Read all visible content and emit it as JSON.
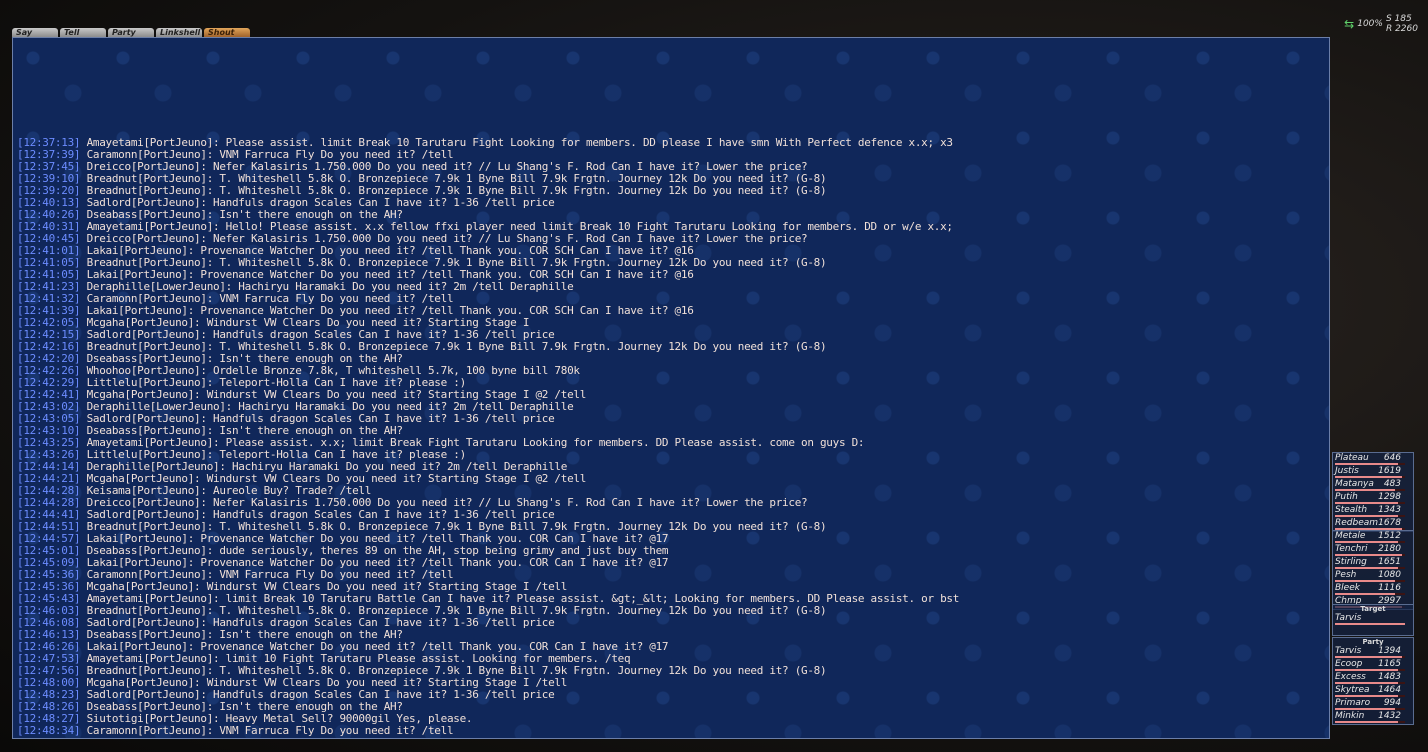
{
  "tabs": [
    {
      "label": "Say"
    },
    {
      "label": "Tell"
    },
    {
      "label": "Party"
    },
    {
      "label": "Linkshell"
    },
    {
      "label": "Shout"
    }
  ],
  "status": {
    "pct": "100%",
    "s": "S 185",
    "r": "R 2260"
  },
  "chat": {
    "lines": [
      {
        "ts": "[12:37:13]",
        "text": "Amayetami[PortJeuno]: Please assist. limit Break 10 Tarutaru Fight Looking for members. DD please I have smn With Perfect defence x.x; x3"
      },
      {
        "ts": "[12:37:39]",
        "text": "Caramonn[PortJeuno]: VNM Farruca Fly Do you need it? /tell"
      },
      {
        "ts": "[12:37:45]",
        "text": "Dreicco[PortJeuno]: Nefer Kalasiris 1.750.000 Do you need it? // Lu Shang's F. Rod Can I have it? Lower the price?"
      },
      {
        "ts": "[12:39:10]",
        "text": "Breadnut[PortJeuno]: T. Whiteshell 5.8k O. Bronzepiece 7.9k 1 Byne Bill 7.9k Frgtn. Journey 12k Do you need it? (G-8)"
      },
      {
        "ts": "[12:39:20]",
        "text": "Breadnut[PortJeuno]: T. Whiteshell 5.8k O. Bronzepiece 7.9k 1 Byne Bill 7.9k Frgtn. Journey 12k Do you need it? (G-8)"
      },
      {
        "ts": "[12:40:13]",
        "text": "Sadlord[PortJeuno]: Handfuls dragon Scales Can I have it? 1-36 /tell price"
      },
      {
        "ts": "[12:40:26]",
        "text": "Dseabass[PortJeuno]: Isn't there enough on the AH?"
      },
      {
        "ts": "[12:40:31]",
        "text": "Amayetami[PortJeuno]: Hello! Please assist. x.x fellow ffxi player need limit Break 10 Fight Tarutaru Looking for members. DD or w/e x.x;"
      },
      {
        "ts": "[12:40:45]",
        "text": "Dreicco[PortJeuno]: Nefer Kalasiris 1.750.000 Do you need it? // Lu Shang's F. Rod Can I have it? Lower the price?"
      },
      {
        "ts": "[12:41:01]",
        "text": "Lakai[PortJeuno]: Provenance Watcher Do you need it? /tell Thank you. COR SCH Can I have it? @16"
      },
      {
        "ts": "[12:41:05]",
        "text": "Breadnut[PortJeuno]: T. Whiteshell 5.8k O. Bronzepiece 7.9k 1 Byne Bill 7.9k Frgtn. Journey 12k Do you need it? (G-8)"
      },
      {
        "ts": "[12:41:05]",
        "text": "Lakai[PortJeuno]: Provenance Watcher Do you need it? /tell Thank you. COR SCH Can I have it? @16"
      },
      {
        "ts": "[12:41:23]",
        "text": "Deraphille[LowerJeuno]: Hachiryu Haramaki Do you need it? 2m /tell Deraphille"
      },
      {
        "ts": "[12:41:32]",
        "text": "Caramonn[PortJeuno]: VNM Farruca Fly Do you need it? /tell"
      },
      {
        "ts": "[12:41:39]",
        "text": "Lakai[PortJeuno]: Provenance Watcher Do you need it? /tell Thank you. COR SCH Can I have it? @16"
      },
      {
        "ts": "[12:42:05]",
        "text": "Mcgaha[PortJeuno]: Windurst VW Clears Do you need it? Starting Stage I"
      },
      {
        "ts": "[12:42:15]",
        "text": "Sadlord[PortJeuno]: Handfuls dragon Scales Can I have it? 1-36 /tell price"
      },
      {
        "ts": "[12:42:16]",
        "text": "Breadnut[PortJeuno]: T. Whiteshell 5.8k O. Bronzepiece 7.9k 1 Byne Bill 7.9k Frgtn. Journey 12k Do you need it? (G-8)"
      },
      {
        "ts": "[12:42:20]",
        "text": "Dseabass[PortJeuno]: Isn't there enough on the AH?"
      },
      {
        "ts": "[12:42:26]",
        "text": "Whoohoo[PortJeuno]: Ordelle Bronze 7.8k, T whiteshell 5.7k, 100 byne bill 780k"
      },
      {
        "ts": "[12:42:29]",
        "text": "Littlelu[PortJeuno]: Teleport-Holla Can I have it? please :)"
      },
      {
        "ts": "[12:42:41]",
        "text": "Mcgaha[PortJeuno]: Windurst VW Clears Do you need it? Starting Stage I @2 /tell"
      },
      {
        "ts": "[12:43:02]",
        "text": "Deraphille[LowerJeuno]: Hachiryu Haramaki Do you need it? 2m /tell Deraphille"
      },
      {
        "ts": "[12:43:05]",
        "text": "Sadlord[PortJeuno]: Handfuls dragon Scales Can I have it? 1-36 /tell price"
      },
      {
        "ts": "[12:43:10]",
        "text": "Dseabass[PortJeuno]: Isn't there enough on the AH?"
      },
      {
        "ts": "[12:43:25]",
        "text": "Amayetami[PortJeuno]: Please assist. x.x; limit Break Fight Tarutaru Looking for members. DD Please assist. come on guys D:"
      },
      {
        "ts": "[12:43:26]",
        "text": "Littlelu[PortJeuno]: Teleport-Holla Can I have it? please :)"
      },
      {
        "ts": "[12:44:14]",
        "text": "Deraphille[PortJeuno]: Hachiryu Haramaki Do you need it? 2m /tell Deraphille"
      },
      {
        "ts": "[12:44:21]",
        "text": "Mcgaha[PortJeuno]: Windurst VW Clears Do you need it? Starting Stage I @2 /tell"
      },
      {
        "ts": "[12:44:28]",
        "text": "Keisama[PortJeuno]: Aureole Buy? Trade? /tell"
      },
      {
        "ts": "[12:44:28]",
        "text": "Dreicco[PortJeuno]: Nefer Kalasiris 1.750.000 Do you need it? // Lu Shang's F. Rod Can I have it? Lower the price?"
      },
      {
        "ts": "[12:44:41]",
        "text": "Sadlord[PortJeuno]: Handfuls dragon Scales Can I have it? 1-36 /tell price"
      },
      {
        "ts": "[12:44:51]",
        "text": "Breadnut[PortJeuno]: T. Whiteshell 5.8k O. Bronzepiece 7.9k 1 Byne Bill 7.9k Frgtn. Journey 12k Do you need it? (G-8)"
      },
      {
        "ts": "[12:44:57]",
        "text": "Lakai[PortJeuno]: Provenance Watcher Do you need it? /tell Thank you. COR Can I have it? @17"
      },
      {
        "ts": "[12:45:01]",
        "text": "Dseabass[PortJeuno]: dude seriously, theres 89 on the AH, stop being grimy and just buy them"
      },
      {
        "ts": "[12:45:09]",
        "text": "Lakai[PortJeuno]: Provenance Watcher Do you need it? /tell Thank you. COR Can I have it? @17"
      },
      {
        "ts": "[12:45:36]",
        "text": "Caramonn[PortJeuno]: VNM Farruca Fly Do you need it? /tell"
      },
      {
        "ts": "[12:45:36]",
        "text": "Mcgaha[PortJeuno]: Windurst VW Clears Do you need it? Starting Stage I /tell"
      },
      {
        "ts": "[12:45:43]",
        "text": "Amayetami[PortJeuno]: limit Break 10 Tarutaru Battle Can I have it? Please assist. &gt;_&lt; Looking for members. DD Please assist. or bst"
      },
      {
        "ts": "[12:46:03]",
        "text": "Breadnut[PortJeuno]: T. Whiteshell 5.8k O. Bronzepiece 7.9k 1 Byne Bill 7.9k Frgtn. Journey 12k Do you need it? (G-8)"
      },
      {
        "ts": "[12:46:08]",
        "text": "Sadlord[PortJeuno]: Handfuls dragon Scales Can I have it? 1-36 /tell price"
      },
      {
        "ts": "[12:46:13]",
        "text": "Dseabass[PortJeuno]: Isn't there enough on the AH?"
      },
      {
        "ts": "[12:46:26]",
        "text": "Lakai[PortJeuno]: Provenance Watcher Do you need it? /tell Thank you. COR Can I have it? @17"
      },
      {
        "ts": "[12:47:53]",
        "text": "Amayetami[PortJeuno]: limit 10 Fight Tarutaru Please assist. Looking for members. /teq"
      },
      {
        "ts": "[12:47:56]",
        "text": "Breadnut[PortJeuno]: T. Whiteshell 5.8k O. Bronzepiece 7.9k 1 Byne Bill 7.9k Frgtn. Journey 12k Do you need it? (G-8)"
      },
      {
        "ts": "[12:48:00]",
        "text": "Mcgaha[PortJeuno]: Windurst VW Clears Do you need it? Starting Stage I /tell"
      },
      {
        "ts": "[12:48:23]",
        "text": "Sadlord[PortJeuno]: Handfuls dragon Scales Can I have it? 1-36 /tell price"
      },
      {
        "ts": "[12:48:26]",
        "text": "Dseabass[PortJeuno]: Isn't there enough on the AH?"
      },
      {
        "ts": "[12:48:27]",
        "text": "Siutotigi[PortJeuno]: Heavy Metal Sell? 90000gil Yes, please."
      },
      {
        "ts": "[12:48:34]",
        "text": "Caramonn[PortJeuno]: VNM Farruca Fly Do you need it? /tell"
      }
    ]
  },
  "alliance1": [
    {
      "name": "Plateau",
      "value": "646",
      "fill": 0.9
    },
    {
      "name": "Justis",
      "value": "1619",
      "fill": 0.95
    },
    {
      "name": "Matanya",
      "value": "483",
      "fill": 0.85
    },
    {
      "name": "Putih",
      "value": "1298",
      "fill": 0.9
    },
    {
      "name": "Stealth",
      "value": "1343",
      "fill": 0.9
    },
    {
      "name": "Redbeam",
      "value": "1678",
      "fill": 0.95
    }
  ],
  "alliance2": [
    {
      "name": "Metale",
      "value": "1512",
      "fill": 0.9
    },
    {
      "name": "Tenchri",
      "value": "2180",
      "fill": 0.95
    },
    {
      "name": "Stirling",
      "value": "1651",
      "fill": 0.9
    },
    {
      "name": "Pesh",
      "value": "1080",
      "fill": 0.85
    },
    {
      "name": "Bleek",
      "value": "1116",
      "fill": 0.85
    },
    {
      "name": "Chmp",
      "value": "2997",
      "fill": 0.95
    }
  ],
  "target": {
    "header": "Target",
    "name": "Tarvis",
    "fill": 1.0
  },
  "party": {
    "header": "Party",
    "members": [
      {
        "name": "Tarvis",
        "value": "1394",
        "fill": 0.95
      },
      {
        "name": "Ecoop",
        "value": "1165",
        "fill": 0.9
      },
      {
        "name": "Excess",
        "value": "1483",
        "fill": 0.9
      },
      {
        "name": "Skytrea",
        "value": "1464",
        "fill": 0.9
      },
      {
        "name": "Primaro",
        "value": "994",
        "fill": 0.85
      },
      {
        "name": "Minkin",
        "value": "1432",
        "fill": 0.9
      }
    ]
  }
}
